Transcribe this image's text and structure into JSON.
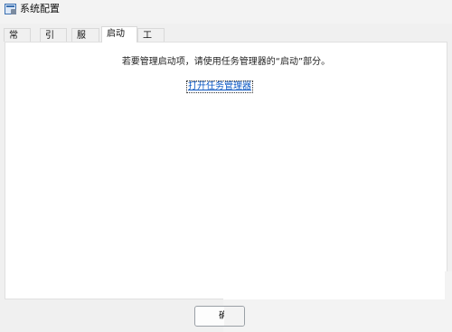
{
  "window": {
    "title": "系统配置",
    "icon": "msconfig-icon"
  },
  "tabs": [
    {
      "label": "常规",
      "active": false
    },
    {
      "label": "引导",
      "active": false
    },
    {
      "label": "服务",
      "active": false
    },
    {
      "label": "启动",
      "active": true
    },
    {
      "label": "工具",
      "active": false
    }
  ],
  "startup": {
    "instruction": "若要管理启动项，请使用任务管理器的“启动”部分。",
    "link_text": "打开任务管理器"
  },
  "buttons": {
    "ok_label": "确"
  }
}
